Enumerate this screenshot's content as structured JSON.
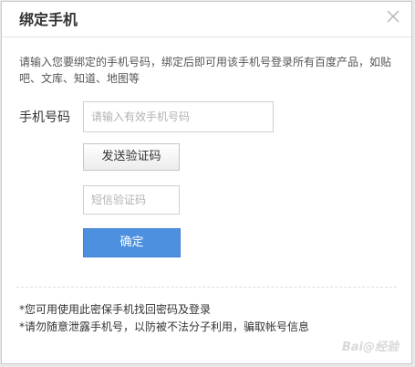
{
  "dialog": {
    "title": "绑定手机",
    "close_icon": "close-icon"
  },
  "description": "请输入您要绑定的手机号码，绑定后即可用该手机号登录所有百度产品，如贴吧、文库、知道、地图等",
  "phone": {
    "label": "手机号码",
    "placeholder": "请输入有效手机号码",
    "value": ""
  },
  "send_code_button": "发送验证码",
  "code": {
    "placeholder": "短信验证码",
    "value": ""
  },
  "confirm_button": "确定",
  "notes": [
    "*您可用使用此密保手机找回密码及登录",
    "*请勿随意泄露手机号，以防被不法分子利用，骗取帐号信息"
  ],
  "watermark": "Bai@经验",
  "colors": {
    "confirm": "#4d90e0",
    "title_text": "#333333"
  }
}
